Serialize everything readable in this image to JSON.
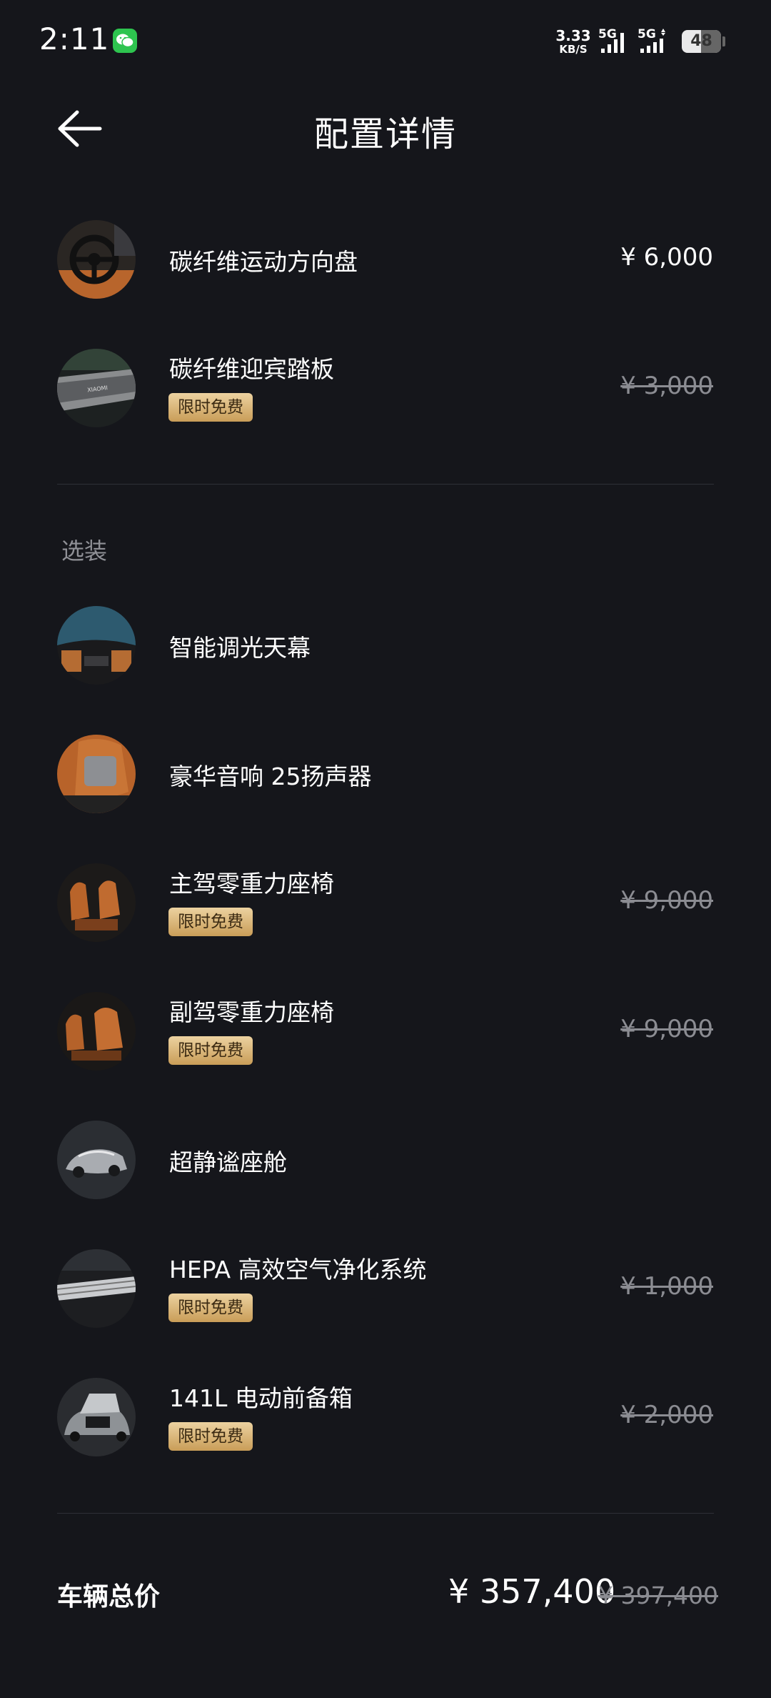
{
  "status_bar": {
    "time": "2:11",
    "net_speed": "3.33",
    "net_unit": "KB/S",
    "sim1": "5G",
    "sim2": "5G",
    "battery": "48"
  },
  "header": {
    "title": "配置详情"
  },
  "standard_items": [
    {
      "name": "碳纤维运动方向盘",
      "price": "¥ 6,000",
      "price_struck": false,
      "badge": ""
    },
    {
      "name": "碳纤维迎宾踏板",
      "price": "¥ 3,000",
      "price_struck": true,
      "badge": "限时免费"
    }
  ],
  "options_section": {
    "label": "选装"
  },
  "option_items": [
    {
      "name": "智能调光天幕",
      "price": "",
      "badge": ""
    },
    {
      "name": "豪华音响 25扬声器",
      "price": "",
      "badge": ""
    },
    {
      "name": "主驾零重力座椅",
      "price": "¥ 9,000",
      "price_struck": true,
      "badge": "限时免费"
    },
    {
      "name": "副驾零重力座椅",
      "price": "¥ 9,000",
      "price_struck": true,
      "badge": "限时免费"
    },
    {
      "name": "超静谧座舱",
      "price": "",
      "badge": ""
    },
    {
      "name": "HEPA 高效空气净化系统",
      "price": "¥ 1,000",
      "price_struck": true,
      "badge": "限时免费"
    },
    {
      "name": "141L 电动前备箱",
      "price": "¥ 2,000",
      "price_struck": true,
      "badge": "限时免费"
    }
  ],
  "total": {
    "label": "车辆总价",
    "price": "¥ 357,400",
    "original_price": "¥ 397,400"
  },
  "colors": {
    "background": "#15161b",
    "badge_gold": "#d9b57a",
    "muted_text": "#8b8c92"
  }
}
